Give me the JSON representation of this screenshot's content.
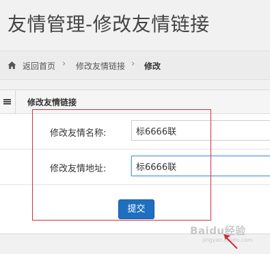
{
  "page": {
    "title": "友情管理-修改友情链接"
  },
  "breadcrumb": {
    "home_icon": "home-icon",
    "items": [
      "返回首页",
      "修改友情链接",
      "修改"
    ],
    "separator": "›"
  },
  "panel": {
    "header_icon": "list-icon",
    "title": "修改友情链接",
    "fields": [
      {
        "label": "修改友情名称:",
        "value": "标6666联"
      },
      {
        "label": "修改友情地址:",
        "value": "标6666联"
      }
    ],
    "submit_label": "提交"
  },
  "colors": {
    "accent": "#1e6fc0",
    "highlight": "#c8323c",
    "focus_border": "#5b9bd5"
  },
  "watermark": {
    "text": "Baidu经验",
    "sub": "jingyan.baidu.com"
  }
}
